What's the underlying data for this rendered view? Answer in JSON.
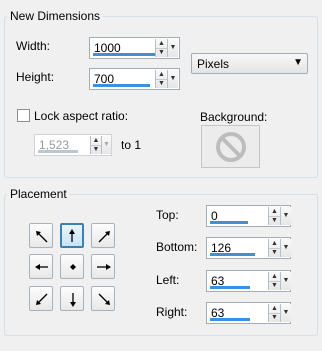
{
  "new_dimensions": {
    "title": "New Dimensions",
    "width_label": "Width:",
    "width_value": "1000",
    "height_label": "Height:",
    "height_value": "700",
    "units": "Pixels",
    "lock_label": "Lock aspect ratio:",
    "lock_checked": false,
    "ratio_value": "1,523",
    "ratio_suffix": "to 1",
    "background_label": "Background:"
  },
  "placement": {
    "title": "Placement",
    "selected": "top-center",
    "top_label": "Top:",
    "top_value": "0",
    "bottom_label": "Bottom:",
    "bottom_value": "126",
    "left_label": "Left:",
    "left_value": "63",
    "right_label": "Right:",
    "right_value": "63"
  },
  "colors": {
    "accent_bar": "#3d8fe0",
    "selected_border": "#3c7fb1"
  },
  "icons": {
    "background": "no-symbol-icon",
    "arrows": [
      "arrow-up-left-icon",
      "arrow-up-icon",
      "arrow-up-right-icon",
      "arrow-left-icon",
      "center-dot-icon",
      "arrow-right-icon",
      "arrow-down-left-icon",
      "arrow-down-icon",
      "arrow-down-right-icon"
    ]
  }
}
